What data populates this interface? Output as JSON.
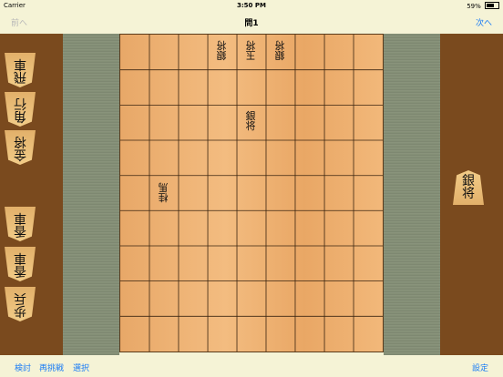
{
  "status": {
    "carrier": "Carrier",
    "time": "3:50 PM",
    "battery": "59%",
    "battery_level": 0.59
  },
  "nav": {
    "prev_label": "前へ",
    "title": "問1",
    "next_label": "次へ"
  },
  "left_hand": [
    {
      "name": "飛",
      "count": "車"
    },
    {
      "name": "角",
      "count": "行"
    },
    {
      "name": "金",
      "count": "将"
    },
    {
      "name": "香",
      "count": "車"
    },
    {
      "name": "香",
      "count": "車"
    },
    {
      "name": "歩",
      "count": "兵"
    }
  ],
  "right_hand": [
    {
      "name": "銀",
      "sub": "将"
    }
  ],
  "board_pieces": [
    {
      "id": "b1",
      "a": "銀",
      "b": "将"
    },
    {
      "id": "b2",
      "a": "玉",
      "b": "将"
    },
    {
      "id": "b3",
      "a": "銀",
      "b": "将"
    },
    {
      "id": "b4",
      "a": "銀",
      "b": "将"
    },
    {
      "id": "b5",
      "a": "桂",
      "b": "馬"
    }
  ],
  "toolbar": {
    "review": "検討",
    "retry": "再挑戦",
    "select": "選択",
    "settings": "設定"
  },
  "colors": {
    "accent": "#1a7cf5",
    "stand": "#7a4a1e",
    "board": "#f0b676"
  }
}
